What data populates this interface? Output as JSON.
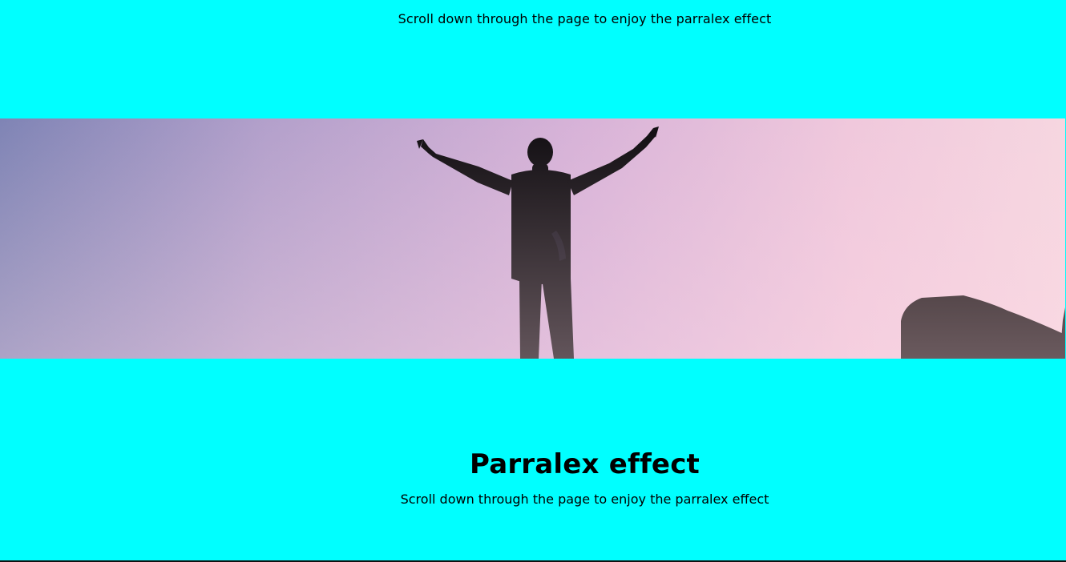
{
  "page": {
    "top_text": "Scroll down through the page to enjoy the parralex effect",
    "hero": {
      "image_label": "silhouette-person-arms-raised"
    },
    "bottom_title": "Parralex effect",
    "bottom_text": "Scroll down through the page to enjoy the parralex effect"
  },
  "colors": {
    "background": "#00ffff",
    "text": "#000000"
  }
}
